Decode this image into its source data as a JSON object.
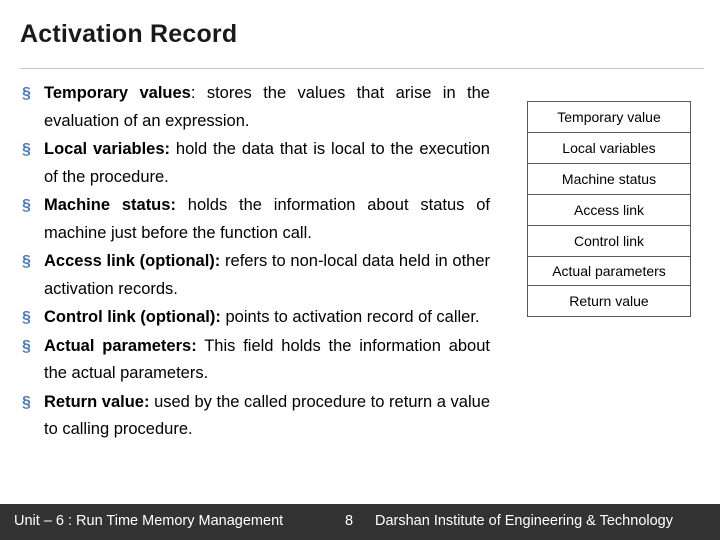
{
  "slide": {
    "title": "Activation Record",
    "bullet_marker": "§",
    "bullets": [
      {
        "term": "Temporary values",
        "rest": ": stores the values that arise in the evaluation of an expression."
      },
      {
        "term": "Local variables:",
        "rest": " hold the data that is local to the execution of the procedure."
      },
      {
        "term": "Machine status:",
        "rest": " holds the information about status of machine just before the function call."
      },
      {
        "term": "Access link (optional):",
        "rest": " refers to non-local data held in other activation records."
      },
      {
        "term": "Control link (optional):",
        "rest": " points to activation record of caller."
      },
      {
        "term": "Actual parameters:",
        "rest": " This field holds the information about the actual parameters."
      },
      {
        "term": "Return value:",
        "rest": " used by the called procedure to return a value to calling procedure."
      }
    ],
    "diagram": {
      "blocks": [
        "Temporary value",
        "Local variables",
        "Machine status",
        "Access link",
        "Control link",
        "Actual parameters",
        "Return value"
      ]
    },
    "footer": {
      "left": "Unit – 6 : Run Time Memory Management",
      "page": "8",
      "right": "Darshan Institute of Engineering & Technology"
    }
  }
}
